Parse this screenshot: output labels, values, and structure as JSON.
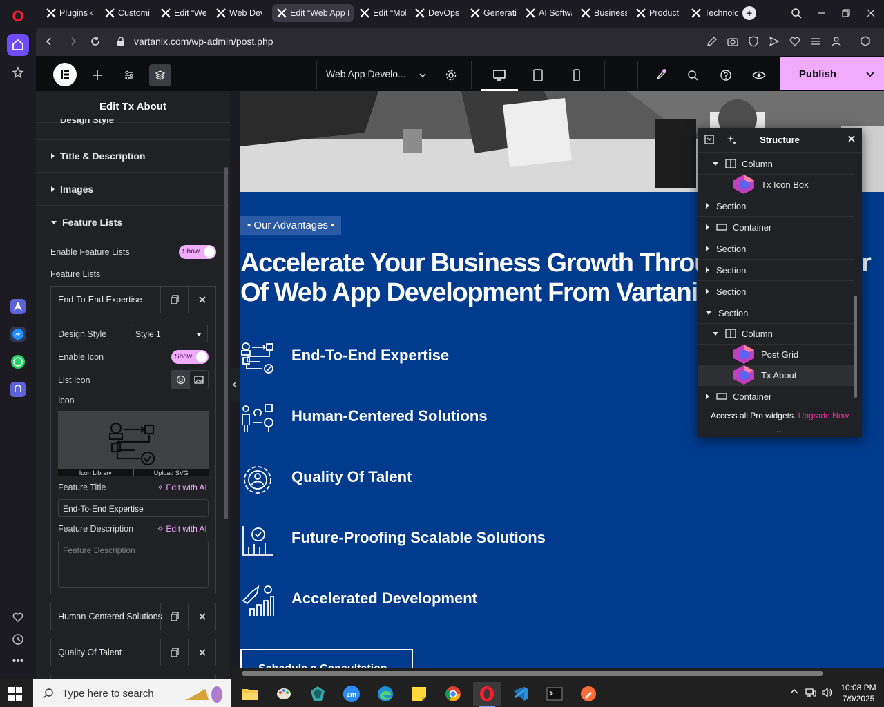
{
  "browser": {
    "tabs": [
      {
        "label": "Plugins ‹"
      },
      {
        "label": "Customiz"
      },
      {
        "label": "Edit “Web"
      },
      {
        "label": "Web Dev"
      },
      {
        "label": "Edit “Web App D"
      },
      {
        "label": "Edit “Mob"
      },
      {
        "label": "DevOps C"
      },
      {
        "label": "Generativ"
      },
      {
        "label": "AI Softwa"
      },
      {
        "label": "Business"
      },
      {
        "label": "Product S"
      },
      {
        "label": "Technolog"
      }
    ],
    "url": "vartanix.com/wp-admin/post.php",
    "new_tab_symbol": "+"
  },
  "editor": {
    "page_name": "Web App Develo...",
    "publish_label": "Publish"
  },
  "panel": {
    "title": "Edit Tx About",
    "partial_section": "Design Style",
    "sections": [
      "Title & Description",
      "Images",
      "Feature Lists"
    ],
    "enable_feature_label": "Enable Feature Lists",
    "enable_feature_value": "Show",
    "feature_lists_label": "Feature Lists",
    "items": [
      "End-To-End Expertise",
      "Human-Centered Solutions",
      "Quality Of Talent"
    ],
    "design_style_label": "Design Style",
    "design_style_value": "Style 1",
    "enable_icon_label": "Enable Icon",
    "enable_icon_value": "Show",
    "list_icon_label": "List Icon",
    "icon_label": "Icon",
    "icon_library": "Icon Library",
    "upload_svg": "Upload SVG",
    "feature_title_label": "Feature Title",
    "edit_ai": "Edit with AI",
    "feature_title_value": "End-To-End Expertise",
    "feature_desc_label": "Feature Description",
    "feature_desc_placeholder": "Feature Description"
  },
  "canvas": {
    "badge": "• Our Advantages •",
    "headline": "Accelerate Your Business Growth Through The Power Of Web App Development From Vartanix",
    "features": [
      "End-To-End Expertise",
      "Human-Centered Solutions",
      "Quality Of Talent",
      "Future-Proofing Scalable Solutions",
      "Accelerated Development"
    ],
    "cta": "Schedule a Consultation"
  },
  "structure": {
    "title": "Structure",
    "nodes": [
      {
        "label": "Column"
      },
      {
        "label": "Tx Icon Box"
      },
      {
        "label": "Section"
      },
      {
        "label": "Container"
      },
      {
        "label": "Section"
      },
      {
        "label": "Section"
      },
      {
        "label": "Section"
      },
      {
        "label": "Section"
      },
      {
        "label": "Column"
      },
      {
        "label": "Post Grid"
      },
      {
        "label": "Tx About"
      },
      {
        "label": "Container"
      }
    ],
    "footer_text": "Access all Pro widgets.",
    "footer_link": "Upgrade Now",
    "more": "..."
  },
  "taskbar": {
    "search_placeholder": "Type here to search",
    "time": "10:08 PM",
    "date": "7/9/2025"
  },
  "colors": {
    "accent": "#f0abfc",
    "canvas_bg": "#003b8e",
    "opera_home": "#6d4dff"
  }
}
